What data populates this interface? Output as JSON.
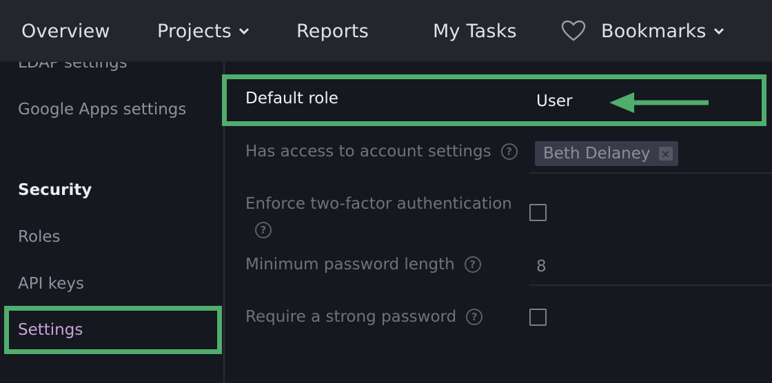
{
  "topnav": {
    "items": [
      {
        "label": "Overview"
      },
      {
        "label": "Projects"
      },
      {
        "label": "Reports"
      },
      {
        "label": "My Tasks"
      },
      {
        "label": "Bookmarks"
      }
    ]
  },
  "sidebar": {
    "items": [
      {
        "label": "LDAP settings"
      },
      {
        "label": "Google Apps settings"
      }
    ],
    "section_heading": "Security",
    "security_items": [
      {
        "label": "Roles"
      },
      {
        "label": "API keys"
      },
      {
        "label": "Settings"
      }
    ]
  },
  "settings": {
    "default_role": {
      "label": "Default role",
      "value": "User"
    },
    "account_access": {
      "label": "Has access to account settings",
      "tag": "Beth Delaney",
      "tag_remove": "×"
    },
    "two_factor": {
      "label": "Enforce two-factor authentication",
      "checked": false
    },
    "min_password": {
      "label": "Minimum password length",
      "value": "8"
    },
    "strong_password": {
      "label": "Require a strong password",
      "checked": false
    },
    "help_glyph": "?"
  },
  "colors": {
    "highlight": "#4fae6e",
    "nav_bg": "#23272c",
    "page_bg": "#15181f",
    "active_item": "#c8a2d8"
  }
}
